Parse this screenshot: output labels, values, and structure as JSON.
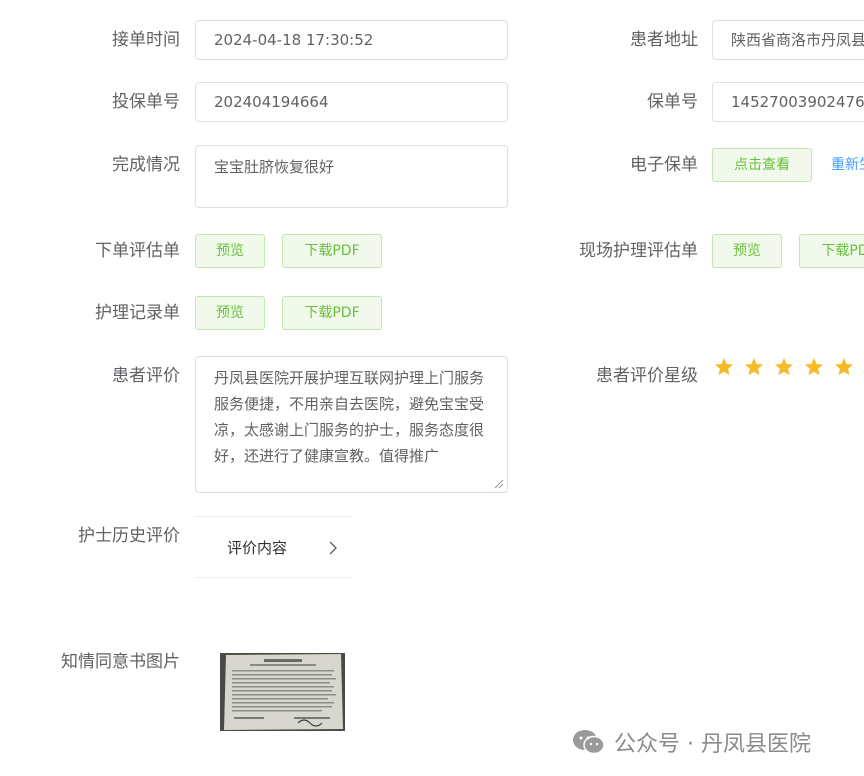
{
  "fields": {
    "accept_time_label": "接单时间",
    "accept_time_value": "2024-04-18 17:30:52",
    "patient_address_label": "患者地址",
    "patient_address_value": "陕西省商洛市丹凤县",
    "policy_application_no_label": "投保单号",
    "policy_application_no_value": "202404194664",
    "policy_no_label": "保单号",
    "policy_no_value": "14527003902476",
    "completion_label": "完成情况",
    "completion_value": "宝宝肚脐恢复很好",
    "e_policy_label": "电子保单",
    "e_policy_view_button": "点击查看",
    "e_policy_regen_link": "重新生成",
    "order_assessment_label": "下单评估单",
    "onsite_assessment_label": "现场护理评估单",
    "nursing_record_label": "护理记录单",
    "preview_button": "预览",
    "download_pdf_button": "下载PDF",
    "patient_review_label": "患者评价",
    "patient_review_value": "丹凤县医院开展护理互联网护理上门服务服务便捷，不用亲自去医院，避免宝宝受凉，太感谢上门服务的护士，服务态度很好，还进行了健康宣教。值得推广",
    "patient_rating_label": "患者评价星级",
    "patient_rating_stars": 5,
    "nurse_history_label": "护士历史评价",
    "nurse_history_item": "评价内容",
    "consent_image_label": "知情同意书图片"
  },
  "watermark": {
    "text": "公众号 · 丹凤县医院",
    "icon": "wechat-icon"
  },
  "colors": {
    "label": "#606266",
    "border": "#dcdfe6",
    "success_bg": "#f0f9eb",
    "success_border": "#c2e7b0",
    "success_text": "#67c23a",
    "link": "#409eff",
    "star": "#f7ba2a"
  }
}
